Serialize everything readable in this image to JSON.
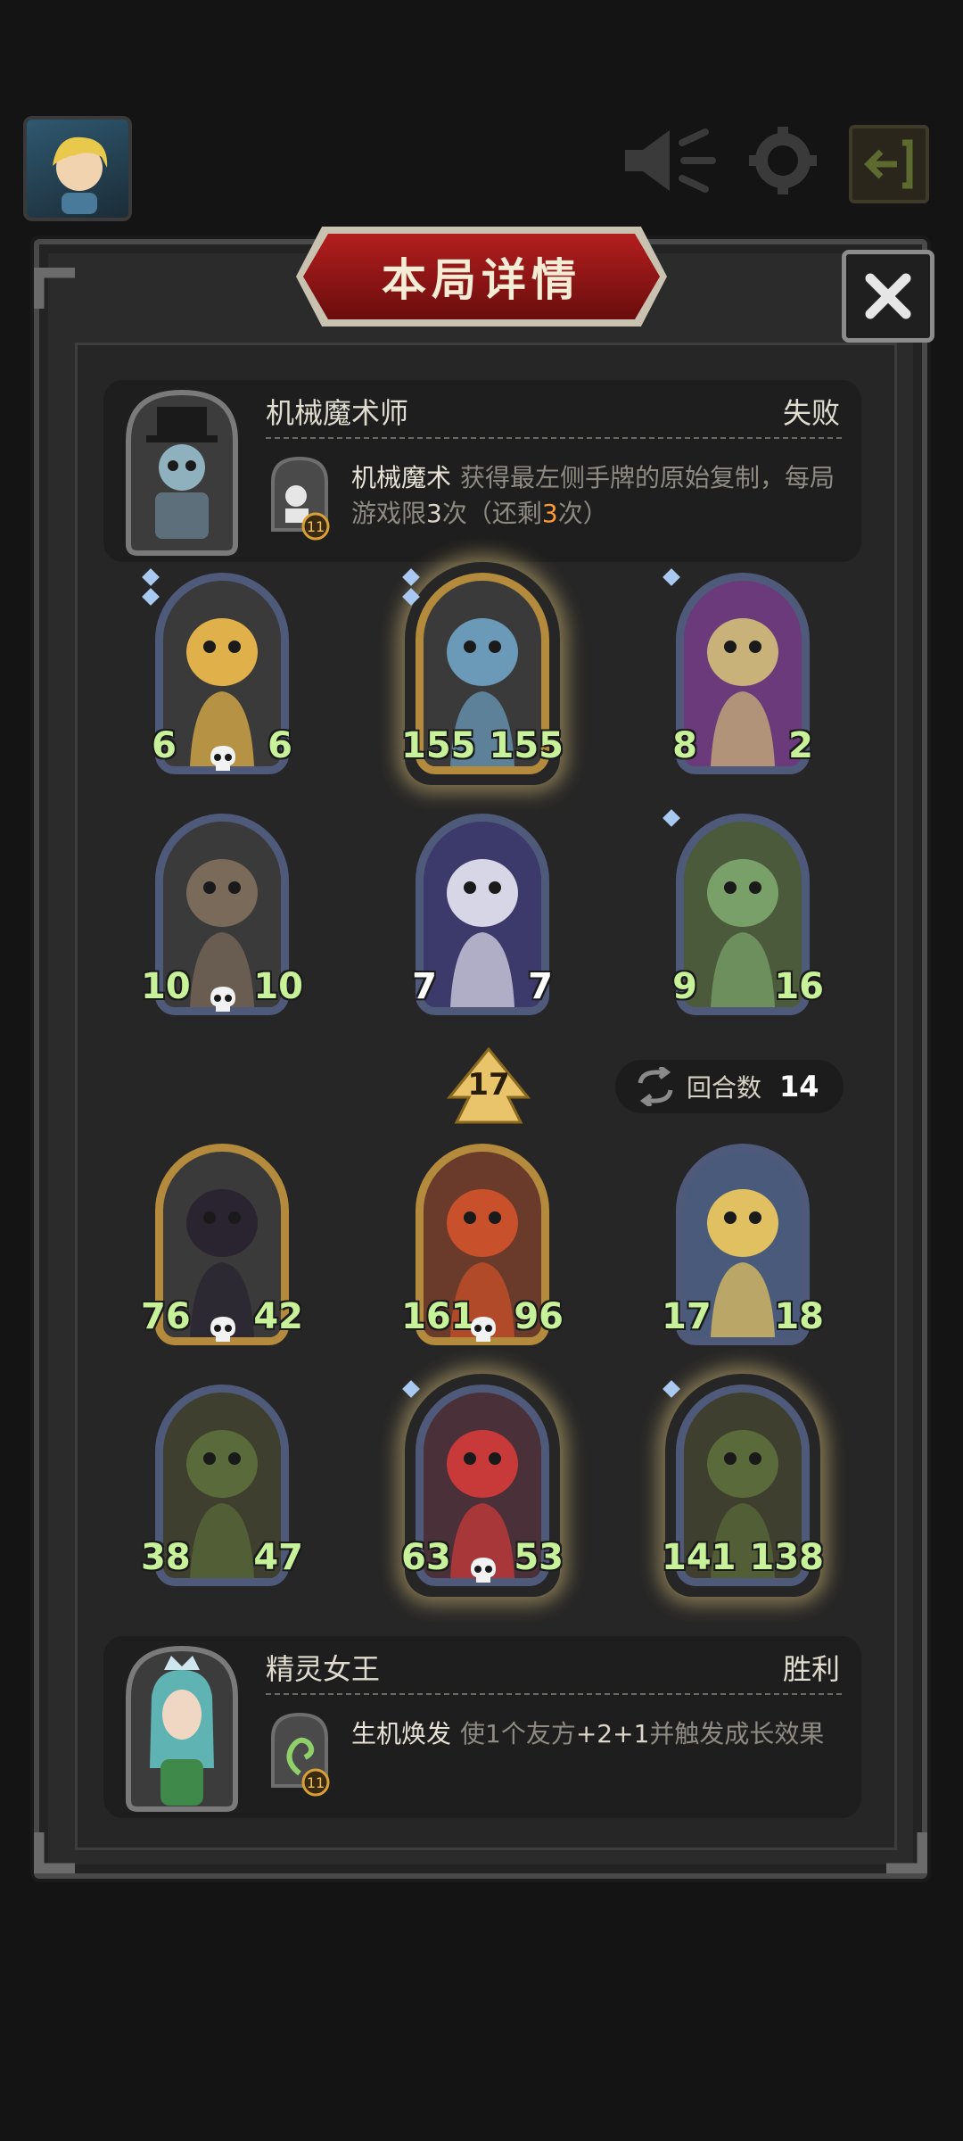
{
  "title": "本局详情",
  "top_player": {
    "name": "机械魔术师",
    "result": "失败",
    "skill_name": "机械魔术",
    "skill_desc_1": "获得最左侧手牌的原始复制，每局游戏限",
    "skill_limit": "3",
    "skill_desc_2": "次（还剩",
    "skill_remaining": "3",
    "skill_desc_3": "次）",
    "skill_level": "11"
  },
  "top_board": [
    {
      "atk": "6",
      "hp": "6",
      "art": "puppet"
    },
    {
      "atk": "155",
      "hp": "155",
      "art": "dragon"
    },
    {
      "atk": "8",
      "hp": "2",
      "art": "elf-knight"
    },
    {
      "atk": "10",
      "hp": "10",
      "art": "bomb"
    },
    {
      "atk": "7",
      "hp": "7",
      "art": "mage"
    },
    {
      "atk": "9",
      "hp": "16",
      "art": "druid"
    }
  ],
  "arrow_value": "17",
  "turns": {
    "label": "回合数",
    "value": "14"
  },
  "bottom_board": [
    {
      "atk": "76",
      "hp": "42",
      "art": "dark-priest"
    },
    {
      "atk": "161",
      "hp": "96",
      "art": "fire-demon"
    },
    {
      "atk": "17",
      "hp": "18",
      "art": "paladin"
    },
    {
      "atk": "38",
      "hp": "47",
      "art": "plant-monster"
    },
    {
      "atk": "63",
      "hp": "53",
      "art": "clown"
    },
    {
      "atk": "141",
      "hp": "138",
      "art": "plant-monster"
    }
  ],
  "bottom_player": {
    "name": "精灵女王",
    "result": "胜利",
    "skill_name": "生机焕发",
    "skill_desc_1": "使1个友方",
    "skill_bonus": "+2+1",
    "skill_desc_2": "并触发成长效果",
    "skill_level": "11"
  },
  "colors": {
    "highlight": "#ff9b2f",
    "atk_bubble": "#3b5f8f",
    "hp_bubble": "#9a2323",
    "stat_text": "#c8f29a",
    "title_red": "#b31e1e"
  }
}
